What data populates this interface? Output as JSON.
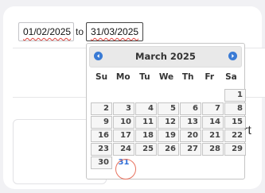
{
  "range": {
    "from_value": "01/02/2025",
    "separator": "to",
    "to_value": "31/03/2025"
  },
  "side_text": "rt",
  "datepicker": {
    "month_title": "March 2025",
    "prev_icon": "chevron-left-icon",
    "next_icon": "chevron-right-icon",
    "weekdays": [
      "Su",
      "Mo",
      "Tu",
      "We",
      "Th",
      "Fr",
      "Sa"
    ],
    "leading_blanks": 6,
    "days": [
      "1",
      "2",
      "3",
      "4",
      "5",
      "6",
      "7",
      "8",
      "9",
      "10",
      "11",
      "12",
      "13",
      "14",
      "15",
      "16",
      "17",
      "18",
      "19",
      "20",
      "21",
      "22",
      "23",
      "24",
      "25",
      "26",
      "27",
      "28",
      "29",
      "30",
      "31"
    ],
    "selected_day": "31"
  },
  "colors": {
    "accent": "#3a7bd5",
    "today_text": "#2f6fd8",
    "highlight_ring": "#e8735f",
    "spell_underline": "#e0413b"
  }
}
